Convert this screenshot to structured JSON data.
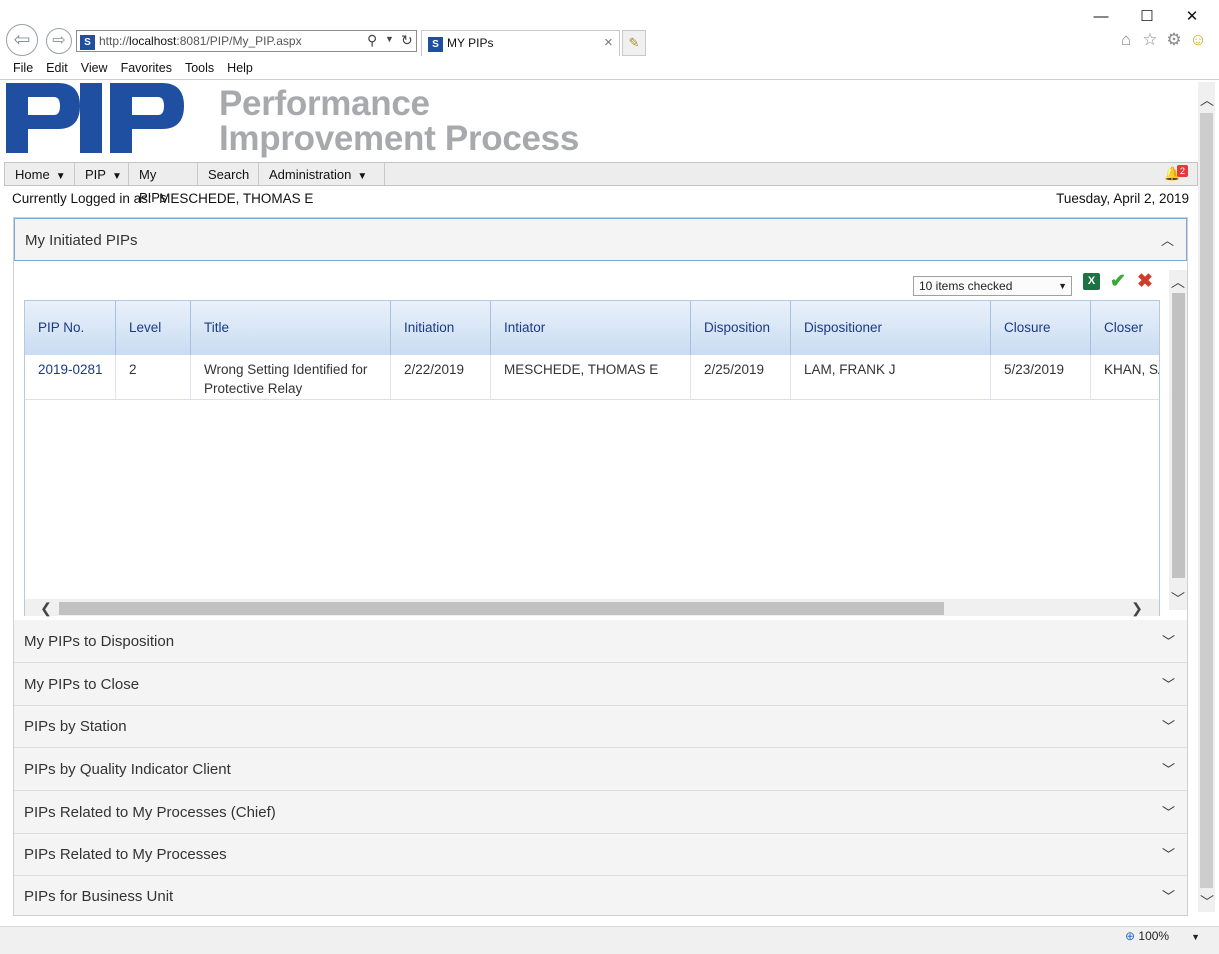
{
  "browser": {
    "url_prefix": "http://",
    "url_host": "localhost",
    "url_rest": ":8081/PIP/My_PIP.aspx",
    "tab_title": "MY PIPs",
    "tab_close": "×",
    "menu": [
      "File",
      "Edit",
      "View",
      "Favorites",
      "Tools",
      "Help"
    ],
    "zoom": "100%"
  },
  "logo": {
    "line1": "Performance",
    "line2": "Improvement Process"
  },
  "topnav": {
    "items": [
      "Home",
      "PIP",
      "My PIPs",
      "Search",
      "Administration"
    ],
    "notification_count": "2"
  },
  "user": {
    "prefix": "Currently Logged in as:",
    "name": "MESCHEDE, THOMAS E",
    "date": "Tuesday, April 2, 2019"
  },
  "sections": {
    "open_title": "My Initiated PIPs",
    "collapsed": [
      "My PIPs to Disposition",
      "My PIPs to Close",
      "PIPs by Station",
      "PIPs by Quality Indicator Client",
      "PIPs Related to My Processes (Chief)",
      "PIPs Related to My Processes",
      "PIPs for Business Unit"
    ]
  },
  "grid": {
    "filter_value": "10 items checked",
    "columns": [
      "PIP No.",
      "Level",
      "Title",
      "Initiation",
      "Intiator",
      "Disposition",
      "Dispositioner",
      "Closure",
      "Closer"
    ],
    "rows": [
      {
        "pip_no": "2019-0281",
        "level": "2",
        "title": "Wrong Setting Identified for Protective Relay",
        "initiation": "2/22/2019",
        "initiator": "MESCHEDE, THOMAS E",
        "disposition": "2/25/2019",
        "dispositioner": "LAM, FRANK J",
        "closure": "5/23/2019",
        "closer": "KHAN, SA"
      }
    ]
  },
  "colors": {
    "logo_blue": "#1e4fa0",
    "logo_gray": "#a7a9ac",
    "header_link": "#1a3a86"
  }
}
